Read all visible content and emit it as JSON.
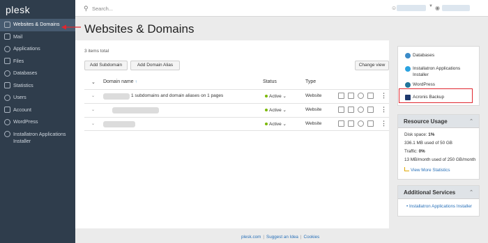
{
  "app": {
    "logo": "plesk"
  },
  "topbar": {
    "search_placeholder": "Search..."
  },
  "sidebar": {
    "items": [
      {
        "label": "Websites & Domains",
        "icon": "monitor-icon",
        "active": true
      },
      {
        "label": "Mail",
        "icon": "mail-icon"
      },
      {
        "label": "Applications",
        "icon": "applications-icon"
      },
      {
        "label": "Files",
        "icon": "files-icon"
      },
      {
        "label": "Databases",
        "icon": "databases-icon"
      },
      {
        "label": "Statistics",
        "icon": "statistics-icon"
      },
      {
        "label": "Users",
        "icon": "users-icon"
      },
      {
        "label": "Account",
        "icon": "account-icon"
      },
      {
        "label": "WordPress",
        "icon": "wordpress-icon"
      },
      {
        "label": "Installatron Applications Installer",
        "icon": "installatron-icon"
      }
    ]
  },
  "main": {
    "title": "Websites & Domains",
    "items_total": "3 items total",
    "buttons": {
      "add_subdomain": "Add Subdomain",
      "add_domain_alias": "Add Domain Alias",
      "change_view": "Change view"
    },
    "table": {
      "headers": {
        "domain": "Domain name",
        "status": "Status",
        "type": "Type",
        "sort_indicator": "↑"
      },
      "rows": [
        {
          "description": "1 subdomains and domain aliases on 1 pages",
          "status": "Active",
          "type": "Website"
        },
        {
          "description": "",
          "status": "Active",
          "type": "Website"
        },
        {
          "description": "",
          "status": "Active",
          "type": "Website"
        }
      ]
    }
  },
  "right_panel": {
    "links": [
      {
        "label": "Databases",
        "icon": "databases-icon",
        "color": "#3a8bc8"
      },
      {
        "label": "Installatron Applications Installer",
        "icon": "installatron-icon",
        "color": "#2ba3e0"
      },
      {
        "label": "WordPress",
        "icon": "wordpress-icon",
        "color": "#21759b"
      },
      {
        "label": "Acronis Backup",
        "icon": "acronis-icon",
        "color": "#1f3a6e"
      }
    ],
    "resource_usage": {
      "title": "Resource Usage",
      "disk_label": "Disk space:",
      "disk_value": "1%",
      "disk_detail": "336.1 MB used of 50 GB",
      "traffic_label": "Traffic:",
      "traffic_value": "0%",
      "traffic_detail": "13 MB/month used of 250 GB/month",
      "stats_link": "View More Statistics"
    },
    "additional_services": {
      "title": "Additional Services",
      "items": [
        "Installatron Applications Installer"
      ]
    }
  },
  "footer": {
    "links": [
      "plesk.com",
      "Suggest an Idea",
      "Cookies"
    ]
  },
  "colors": {
    "sidebar_bg": "#2f3d4c",
    "accent_link": "#2870b8",
    "active_status": "#7ab800",
    "highlight_red": "#e0262e"
  }
}
